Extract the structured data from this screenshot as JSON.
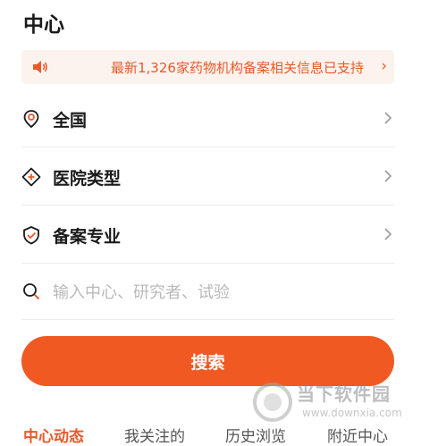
{
  "page": {
    "title": "中心"
  },
  "notice": {
    "text": "最新1,326家药物机构备案相关信息已支持",
    "arrow": "›"
  },
  "filters": [
    {
      "label": "全国",
      "icon": "location-pin-icon"
    },
    {
      "label": "医院类型",
      "icon": "hospital-cross-icon"
    },
    {
      "label": "备案专业",
      "icon": "shield-check-icon"
    }
  ],
  "search": {
    "placeholder": "输入中心、研究者、试验",
    "icon": "search-icon"
  },
  "search_button": {
    "label": "搜索"
  },
  "tabs": [
    {
      "label": "中心动态",
      "active": true
    },
    {
      "label": "我关注的",
      "active": false
    },
    {
      "label": "历史浏览",
      "active": false
    },
    {
      "label": "附近中心",
      "active": false
    }
  ],
  "watermark": {
    "title": "当下软件园",
    "url": "www.downxia.com"
  },
  "colors": {
    "accent": "#f05a22",
    "notice_bg": "#fdf3ee",
    "notice_text": "#e85a2a"
  }
}
